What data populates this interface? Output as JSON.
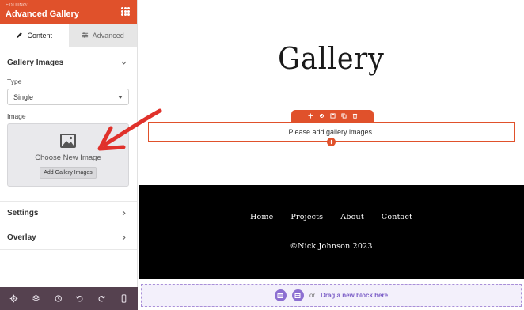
{
  "sidebar": {
    "editing_label": "EDITING:",
    "title": "Advanced Gallery",
    "tabs": [
      {
        "label": "Content",
        "icon": "pencil-icon"
      },
      {
        "label": "Advanced",
        "icon": "sliders-icon"
      }
    ],
    "gallery_images": {
      "heading": "Gallery Images",
      "type_label": "Type",
      "type_value": "Single",
      "image_label": "Image",
      "choose_text": "Choose New Image",
      "add_button": "Add Gallery Images"
    },
    "sections": [
      {
        "label": "Settings"
      },
      {
        "label": "Overlay"
      }
    ],
    "bottom_icons": [
      "gear-icon",
      "layers-icon",
      "history-icon",
      "undo-icon",
      "redo-icon",
      "mobile-preview-icon"
    ]
  },
  "canvas": {
    "title": "Gallery",
    "module_placeholder": "Please add gallery images.",
    "toolbar_icons": [
      "move-icon",
      "settings-icon",
      "save-icon",
      "duplicate-icon",
      "delete-icon"
    ],
    "footer": {
      "nav": [
        "Home",
        "Projects",
        "About",
        "Contact"
      ],
      "copyright": "©Nick Johnson 2023"
    },
    "dropzone": {
      "or": "or",
      "text": "Drag a new block here"
    }
  },
  "colors": {
    "accent": "#e0512b",
    "sidebar_bottom": "#55414f",
    "purple": "#8c6fd1",
    "footer_bg": "#000000"
  }
}
